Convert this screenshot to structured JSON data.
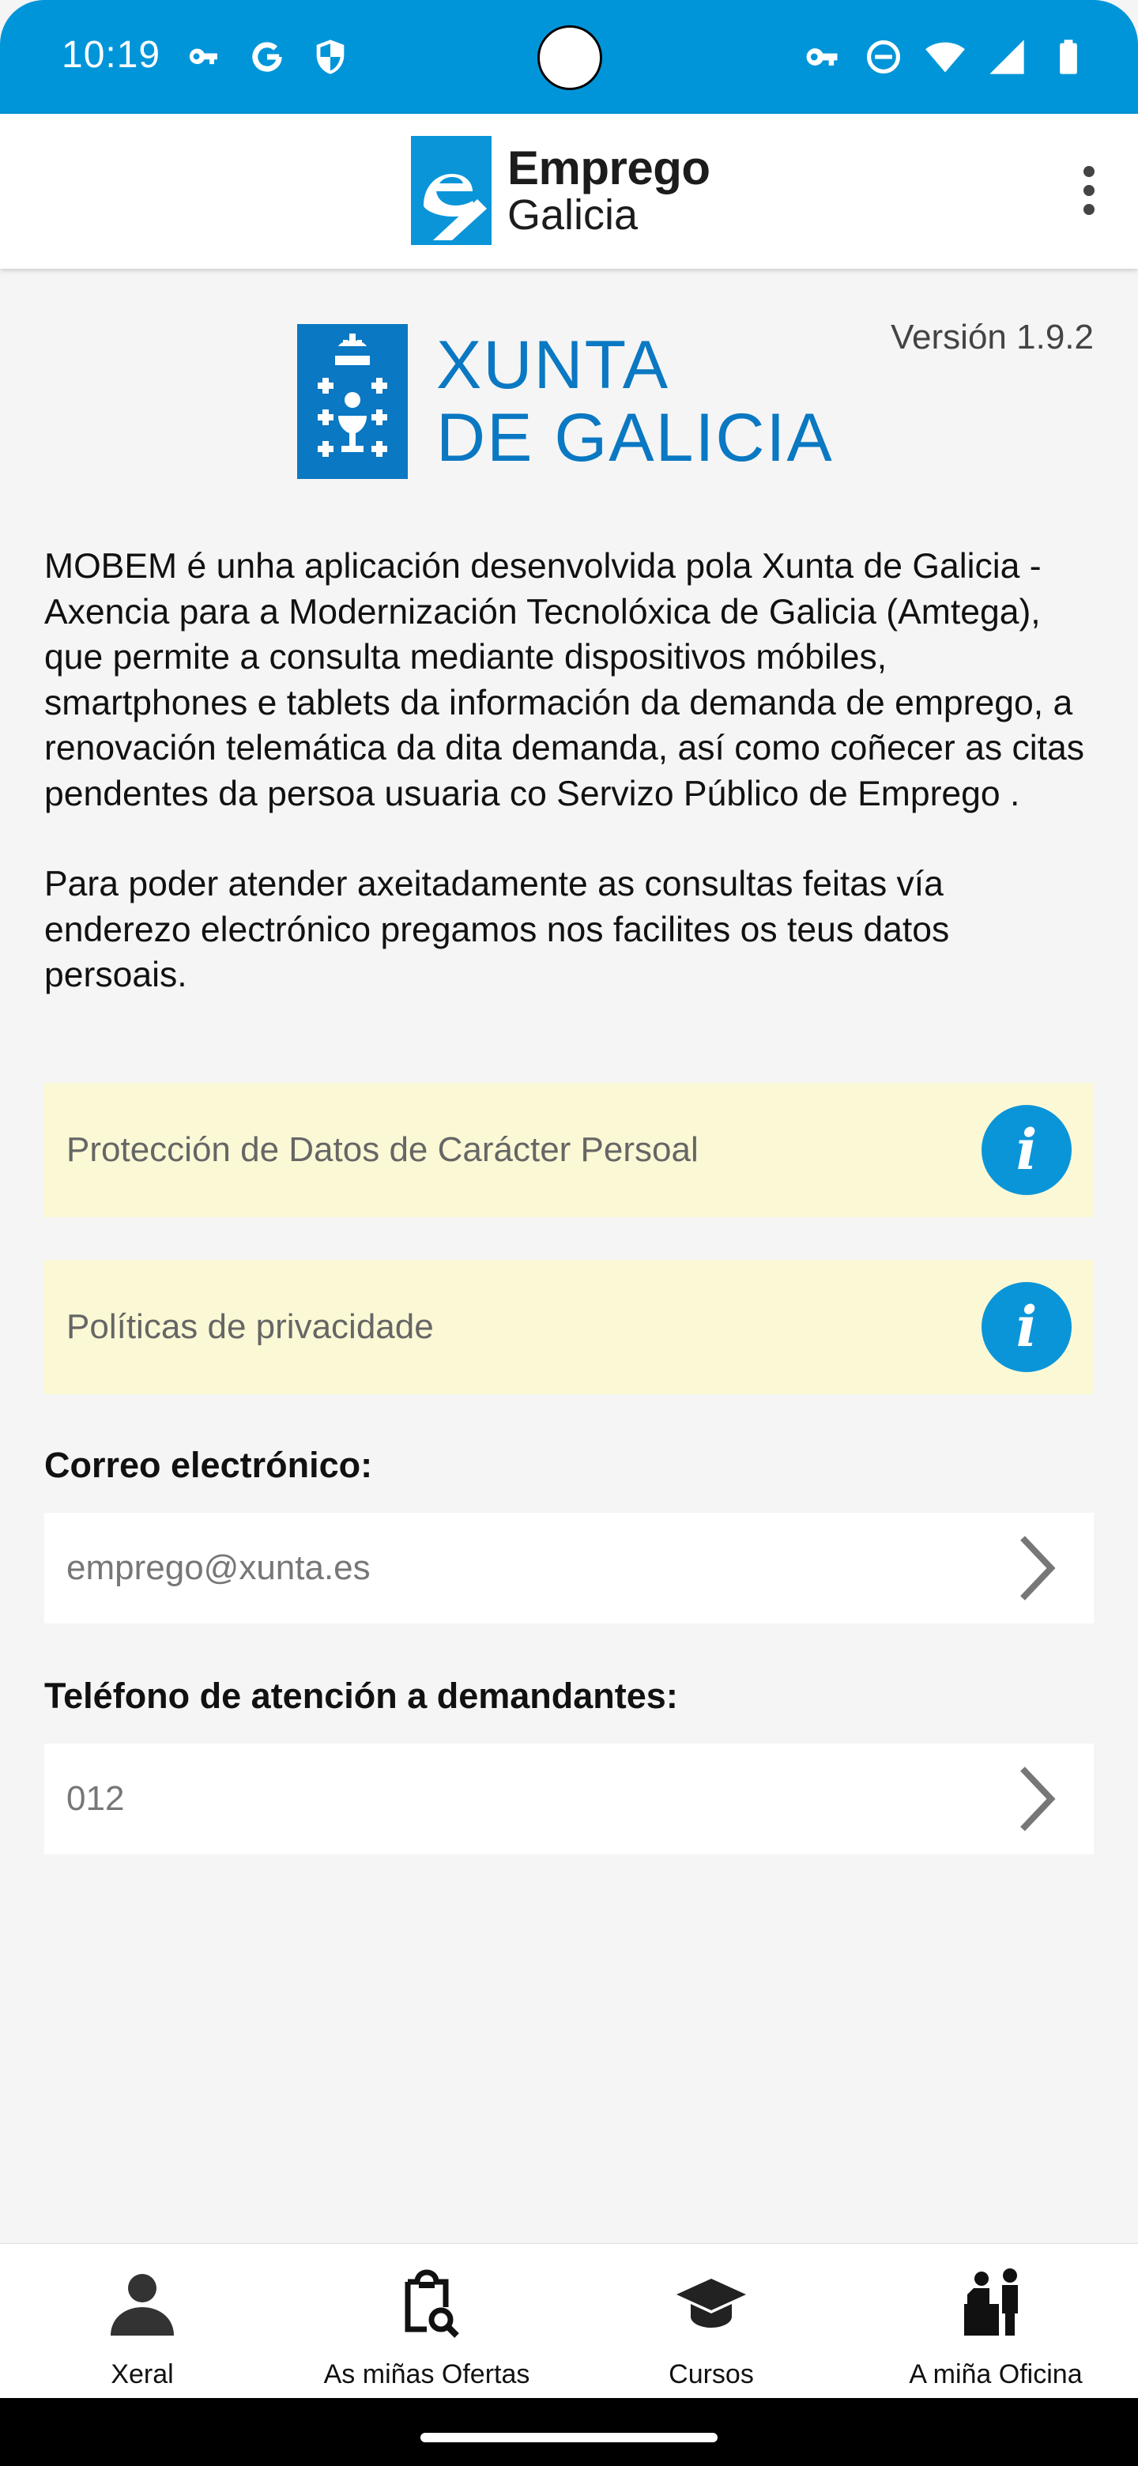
{
  "status_bar": {
    "time": "10:19",
    "left_icons": [
      "vpn-key-icon",
      "google-icon",
      "shield-icon"
    ],
    "right_icons": [
      "vpn-key-icon",
      "do-not-disturb-icon",
      "wifi-icon",
      "signal-icon",
      "battery-icon"
    ],
    "background_color": "#0095d9"
  },
  "app_bar": {
    "brand_line1": "Emprego",
    "brand_line2": "Galicia",
    "menu_icon": "more-vertical-icon"
  },
  "about": {
    "version": "Versión 1.9.2",
    "logo_line1": "XUNTA",
    "logo_line2": "DE GALICIA",
    "paragraph1": "MOBEM é unha aplicación desenvolvida pola Xunta de Galicia - Axencia para a Modernización Tecnolóxica de Galicia (Amtega), que permite a consulta mediante dispositivos móbiles, smartphones e tablets da información da demanda de emprego, a renovación telemática da dita demanda, así como coñecer as citas pendentes da persoa usuaria co Servizo Público de Emprego .",
    "paragraph2": "Para poder atender axeitadamente as consultas feitas vía enderezo electrónico pregamos nos facilites os teus datos persoais."
  },
  "info_rows": [
    {
      "label": "Protección de Datos de Carácter Persoal",
      "icon": "info-icon"
    },
    {
      "label": "Políticas de privacidade",
      "icon": "info-icon"
    }
  ],
  "contact": {
    "email_label": "Correo electrónico:",
    "email_value": "emprego@xunta.es",
    "phone_label": "Teléfono de atención a demandantes:",
    "phone_value": "012"
  },
  "bottom_nav": [
    {
      "label": "Xeral",
      "icon": "person-icon"
    },
    {
      "label": "As miñas Ofertas",
      "icon": "clipboard-search-icon"
    },
    {
      "label": "Cursos",
      "icon": "graduation-cap-icon"
    },
    {
      "label": "A miña Oficina",
      "icon": "office-desk-icon"
    }
  ],
  "colors": {
    "accent": "#0b95d9",
    "xunta_blue": "#0a78c2",
    "info_row_bg": "#fbf9d5"
  }
}
